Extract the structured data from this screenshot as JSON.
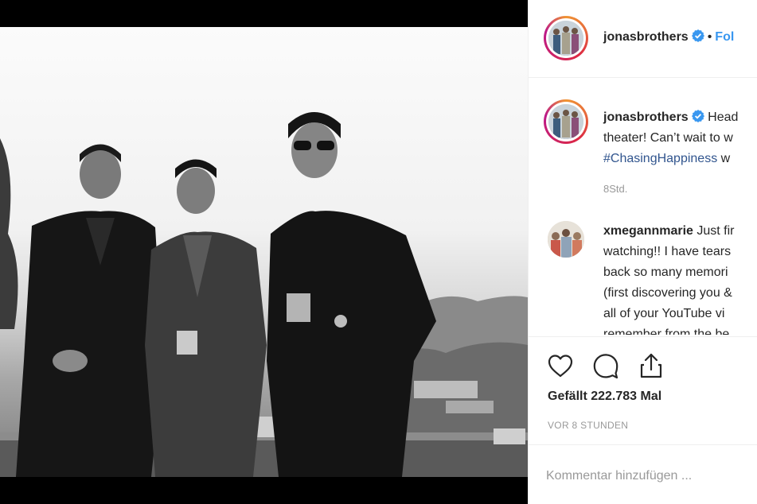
{
  "post": {
    "author": "jonasbrothers",
    "follow_label": "Fol",
    "dot": "•"
  },
  "caption": {
    "username": "jonasbrothers",
    "lines": [
      "Head",
      "theater! Can’t wait to w",
      "#ChasingHappiness",
      " w"
    ],
    "time": "8Std."
  },
  "comment": {
    "username": "xmegannmarie",
    "lines": [
      "Just fir",
      "watching!! I have tears",
      "back so many memori",
      "(first discovering you &",
      "all of your YouTube vi",
      "remember from the be"
    ]
  },
  "actions": {
    "like_icon": "heart-icon",
    "comment_icon": "comment-icon",
    "share_icon": "share-icon"
  },
  "likes": {
    "label": "Gefällt 222.783 Mal"
  },
  "timestamp": "VOR 8 STUNDEN",
  "add_comment": {
    "placeholder": "Kommentar hinzufügen ..."
  },
  "colors": {
    "link": "#3897f0",
    "verified": "#3897f0",
    "text": "#262626",
    "muted": "#999999",
    "hashtag": "#31558e"
  }
}
